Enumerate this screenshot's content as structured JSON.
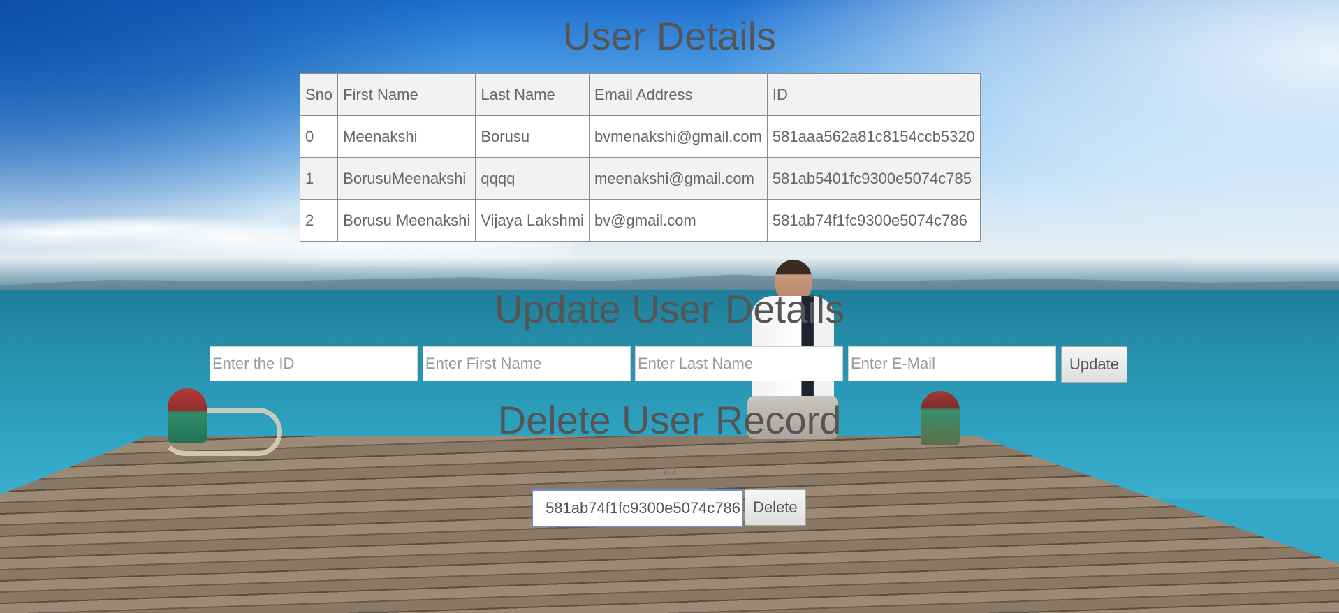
{
  "titles": {
    "main": "User Details",
    "update": "Update User Details",
    "delete": "Delete User Record"
  },
  "table": {
    "headers": [
      "Sno",
      "First Name",
      "Last Name",
      "Email Address",
      "ID"
    ],
    "rows": [
      [
        "0",
        "Meenakshi",
        "Borusu",
        "bvmenakshi@gmail.com",
        "581aaa562a81c8154ccb5320"
      ],
      [
        "1",
        "BorusuMeenakshi",
        "qqqq",
        "meenakshi@gmail.com",
        "581ab5401fc9300e5074c785"
      ],
      [
        "2",
        "Borusu Meenakshi",
        "Vijaya Lakshmi",
        "bv@gmail.com",
        "581ab74f1fc9300e5074c786"
      ]
    ]
  },
  "update_form": {
    "id_placeholder": "Enter the ID",
    "first_name_placeholder": "Enter First Name",
    "last_name_placeholder": "Enter Last Name",
    "email_placeholder": "Enter E-Mail",
    "button_label": "Update"
  },
  "delete_form": {
    "id_label": "ID",
    "id_value": "581ab74f1fc9300e5074c786",
    "button_label": "Delete"
  }
}
